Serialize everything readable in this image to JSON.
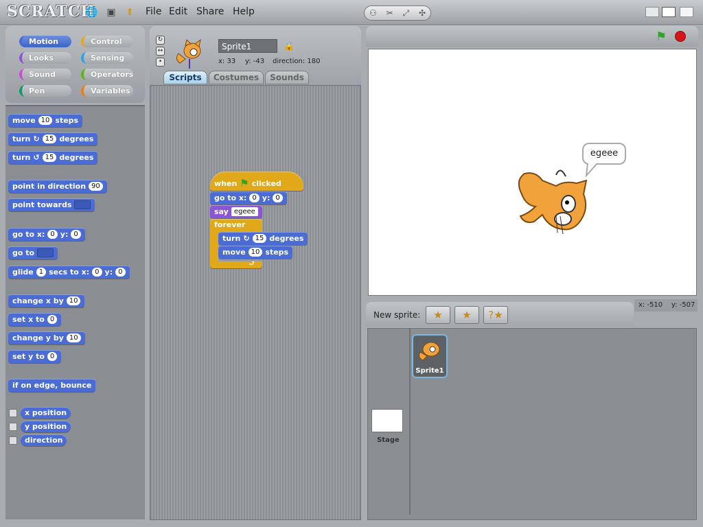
{
  "app": {
    "logo": "SCRATCH",
    "menus": [
      "File",
      "Edit",
      "Share",
      "Help"
    ]
  },
  "categories": [
    {
      "label": "Motion",
      "color": "#4a6cd4",
      "active": true
    },
    {
      "label": "Control",
      "color": "#e1a91a"
    },
    {
      "label": "Looks",
      "color": "#8a55d7"
    },
    {
      "label": "Sensing",
      "color": "#2ca5e2"
    },
    {
      "label": "Sound",
      "color": "#cf4ad9"
    },
    {
      "label": "Operators",
      "color": "#5cb712"
    },
    {
      "label": "Pen",
      "color": "#0e9a6c"
    },
    {
      "label": "Variables",
      "color": "#ee7d16"
    }
  ],
  "palette": {
    "move": {
      "pre": "move",
      "val": "10",
      "post": "steps"
    },
    "turn_cw": {
      "pre": "turn",
      "icon": "↻",
      "val": "15",
      "post": "degrees"
    },
    "turn_ccw": {
      "pre": "turn",
      "icon": "↺",
      "val": "15",
      "post": "degrees"
    },
    "point_dir": {
      "pre": "point in direction",
      "val": "90"
    },
    "point_towards": {
      "pre": "point towards"
    },
    "goto_xy": {
      "pre": "go to x:",
      "x": "0",
      "mid": "y:",
      "y": "0"
    },
    "goto": {
      "pre": "go to"
    },
    "glide": {
      "pre": "glide",
      "secs": "1",
      "mid1": "secs to x:",
      "x": "0",
      "mid2": "y:",
      "y": "0"
    },
    "change_x": {
      "pre": "change x by",
      "val": "10"
    },
    "set_x": {
      "pre": "set x to",
      "val": "0"
    },
    "change_y": {
      "pre": "change y by",
      "val": "10"
    },
    "set_y": {
      "pre": "set y to",
      "val": "0"
    },
    "bounce": {
      "label": "if on edge, bounce"
    },
    "reporters": [
      "x position",
      "y position",
      "direction"
    ]
  },
  "sprite": {
    "name": "Sprite1",
    "x_label": "x: 33",
    "y_label": "y: -43",
    "direction_label": "direction: 180"
  },
  "tabs": [
    "Scripts",
    "Costumes",
    "Sounds"
  ],
  "script": {
    "hat_when": "when",
    "hat_clicked": "clicked",
    "goto_pre": "go to x:",
    "goto_x": "0",
    "goto_mid": "y:",
    "goto_y": "0",
    "say_pre": "say",
    "say_val": "egeee",
    "forever": "forever",
    "turn_pre": "turn",
    "turn_icon": "↻",
    "turn_val": "15",
    "turn_post": "degrees",
    "move_pre": "move",
    "move_val": "10",
    "move_post": "steps"
  },
  "stage": {
    "speech": "egeee",
    "mouse_x": "x: -510",
    "mouse_y": "y: -507"
  },
  "sprites_panel": {
    "new_sprite_label": "New sprite:",
    "sprite_label": "Sprite1",
    "stage_label": "Stage"
  },
  "colors": {
    "green_flag": "#2fa526",
    "stop": "#d6141c"
  }
}
